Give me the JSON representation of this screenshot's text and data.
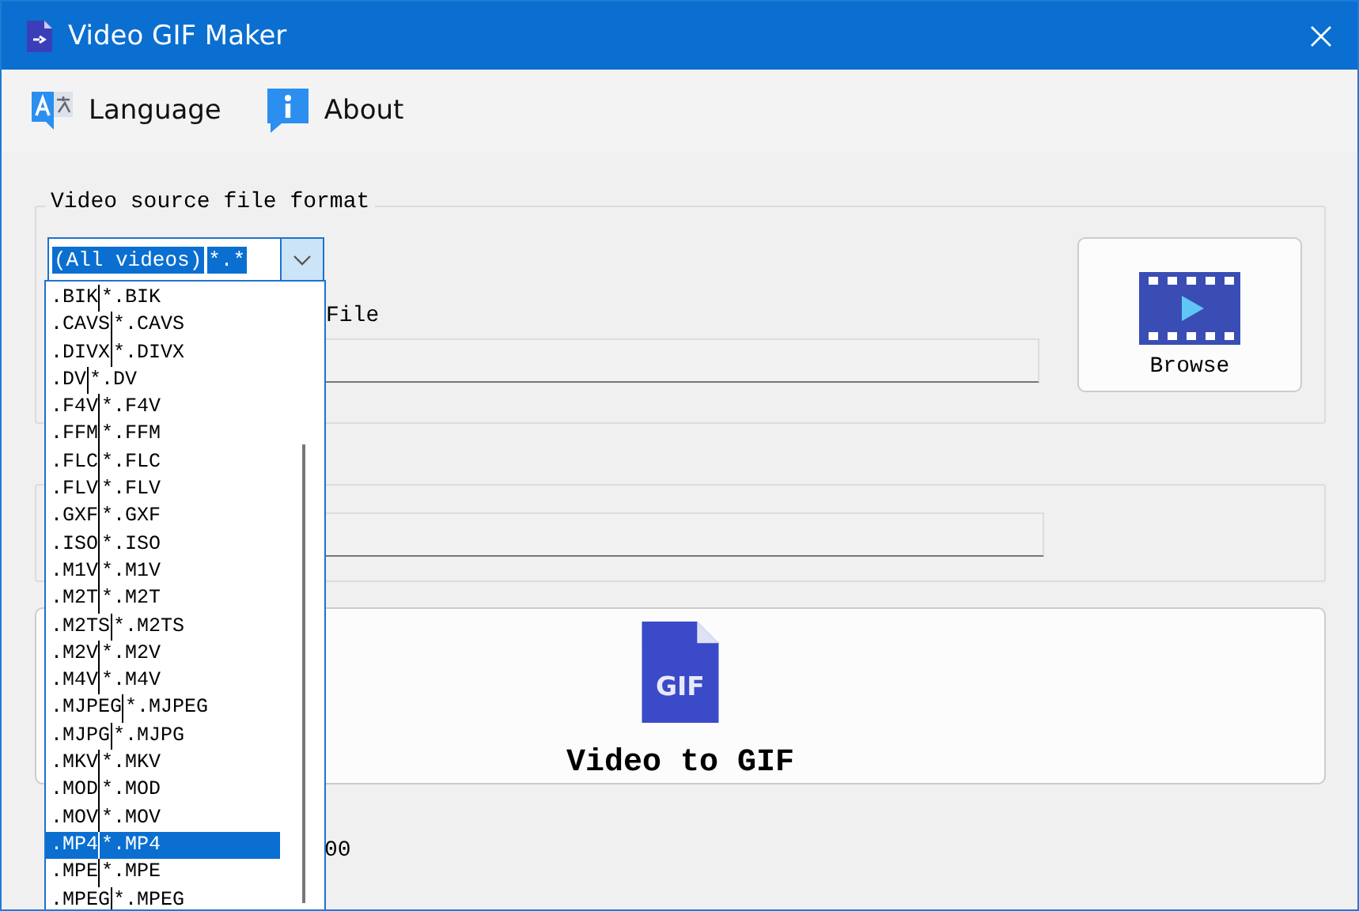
{
  "window": {
    "title": "Video GIF Maker"
  },
  "menu": [
    {
      "kind": "language",
      "label": "Language"
    },
    {
      "kind": "about",
      "label": "About"
    }
  ],
  "source_group": {
    "legend": "Video source file format",
    "format_combo": {
      "name": "(All videos)",
      "pattern": "*.*",
      "expanded": true
    },
    "format_options": [
      {
        "name": ".BIK",
        "pattern": "*.BIK",
        "selected": false
      },
      {
        "name": ".CAVS",
        "pattern": "*.CAVS",
        "selected": false
      },
      {
        "name": ".DIVX",
        "pattern": "*.DIVX",
        "selected": false
      },
      {
        "name": ".DV",
        "pattern": "*.DV",
        "selected": false
      },
      {
        "name": ".F4V",
        "pattern": "*.F4V",
        "selected": false
      },
      {
        "name": ".FFM",
        "pattern": "*.FFM",
        "selected": false
      },
      {
        "name": ".FLC",
        "pattern": "*.FLC",
        "selected": false
      },
      {
        "name": ".FLV",
        "pattern": "*.FLV",
        "selected": false
      },
      {
        "name": ".GXF",
        "pattern": "*.GXF",
        "selected": false
      },
      {
        "name": ".ISO",
        "pattern": "*.ISO",
        "selected": false
      },
      {
        "name": ".M1V",
        "pattern": "*.M1V",
        "selected": false
      },
      {
        "name": ".M2T",
        "pattern": "*.M2T",
        "selected": false
      },
      {
        "name": ".M2TS",
        "pattern": "*.M2TS",
        "selected": false
      },
      {
        "name": ".M2V",
        "pattern": "*.M2V",
        "selected": false
      },
      {
        "name": ".M4V",
        "pattern": "*.M4V",
        "selected": false
      },
      {
        "name": ".MJPEG",
        "pattern": "*.MJPEG",
        "selected": false
      },
      {
        "name": ".MJPG",
        "pattern": "*.MJPG",
        "selected": false
      },
      {
        "name": ".MKV",
        "pattern": "*.MKV",
        "selected": false
      },
      {
        "name": ".MOD",
        "pattern": "*.MOD",
        "selected": false
      },
      {
        "name": ".MOV",
        "pattern": "*.MOV",
        "selected": false
      },
      {
        "name": ".MP4",
        "pattern": "*.MP4",
        "selected": true
      },
      {
        "name": ".MPE",
        "pattern": "*.MPE",
        "selected": false
      },
      {
        "name": ".MPEG",
        "pattern": "*.MPEG",
        "selected": false
      }
    ],
    "file_label": "File",
    "browse_button": "Browse"
  },
  "convert_button": {
    "icon_text": "GIF",
    "label": "Video to GIF"
  },
  "status_text": "00"
}
